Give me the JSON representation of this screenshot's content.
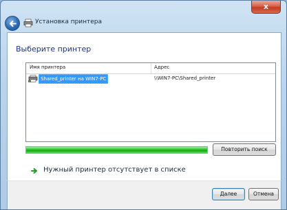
{
  "window": {
    "title": "Установка принтера",
    "close_glyph": "x"
  },
  "content": {
    "heading": "Выберите принтер"
  },
  "printer_list": {
    "columns": [
      "Имя принтера",
      "Адрес"
    ],
    "rows": [
      {
        "name": "Shared_printer на WIN7-PC",
        "address": "\\\\WIN7-PC\\Shared_printer",
        "selected": true
      }
    ]
  },
  "progress": {
    "value": 1.0,
    "color": "#2fc42f"
  },
  "buttons": {
    "retry": "Повторить поиск",
    "next": "Далее",
    "cancel": "Отмена"
  },
  "link": {
    "missing_printer": "Нужный принтер отсутствует в списке"
  },
  "icons": {
    "back": "back-arrow-icon",
    "printer": "printer-icon",
    "link_arrow": "green-arrow-icon"
  },
  "colors": {
    "heading": "#1e3287",
    "selection": "#3399ff"
  }
}
